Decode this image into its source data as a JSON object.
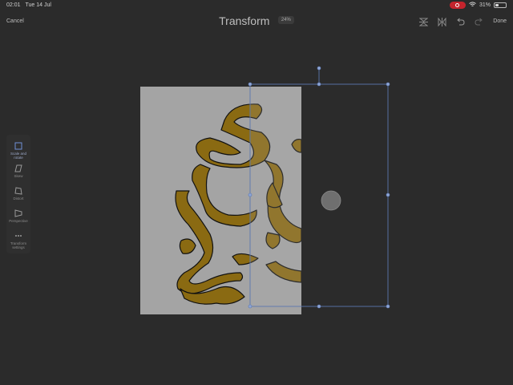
{
  "status": {
    "time": "02:01",
    "date": "Tue 14 Jul",
    "battery": "31%",
    "battery_level": 0.31,
    "icons": [
      "screen-record-icon",
      "wifi-icon",
      "battery-icon"
    ]
  },
  "toolbar": {
    "cancel": "Cancel",
    "title": "Transform",
    "zoom": "24%",
    "done": "Done",
    "icons": [
      "flip-vertical-icon",
      "flip-horizontal-icon",
      "undo-icon",
      "redo-icon"
    ]
  },
  "tools": [
    {
      "label": "Scale and rotate",
      "icon": "scale-rotate-icon",
      "active": true
    },
    {
      "label": "Skew",
      "icon": "skew-icon",
      "active": false
    },
    {
      "label": "Distort",
      "icon": "distort-icon",
      "active": false
    },
    {
      "label": "Perspective",
      "icon": "perspective-icon",
      "active": false
    },
    {
      "label": "Transform settings",
      "icon": "more-icon",
      "active": false
    }
  ],
  "colors": {
    "background": "#2b2b2b",
    "canvas": "#a4a4a4",
    "stroke_fill": "#8a6a12",
    "selection": "#5b77b0",
    "record": "#c4242d"
  }
}
